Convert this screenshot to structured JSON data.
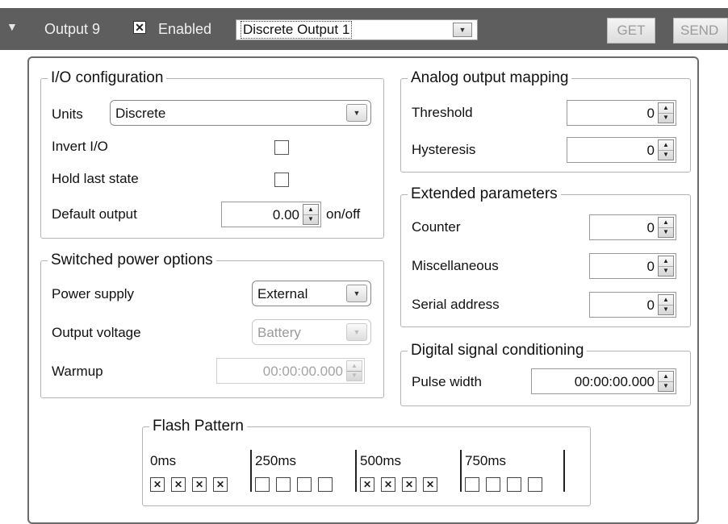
{
  "header": {
    "title": "Output 9",
    "enabled_checked": true,
    "enabled_mark": "✕",
    "enabled_label": "Enabled",
    "output_select_value": "Discrete Output 1",
    "get_label": "GET",
    "send_label": "SEND"
  },
  "io_config": {
    "legend": "I/O configuration",
    "units_label": "Units",
    "units_value": "Discrete",
    "invert_label": "Invert I/O",
    "invert_checked": false,
    "hold_label": "Hold last state",
    "hold_checked": false,
    "default_output_label": "Default output",
    "default_output_value": "0.00",
    "default_output_unit": "on/off"
  },
  "switched_power": {
    "legend": "Switched power options",
    "power_supply_label": "Power supply",
    "power_supply_value": "External",
    "output_voltage_label": "Output voltage",
    "output_voltage_value": "Battery",
    "warmup_label": "Warmup",
    "warmup_value": "00:00:00.000"
  },
  "analog_mapping": {
    "legend": "Analog output mapping",
    "threshold_label": "Threshold",
    "threshold_value": "0",
    "hysteresis_label": "Hysteresis",
    "hysteresis_value": "0"
  },
  "extended": {
    "legend": "Extended parameters",
    "counter_label": "Counter",
    "counter_value": "0",
    "misc_label": "Miscellaneous",
    "misc_value": "0",
    "serial_label": "Serial address",
    "serial_value": "0"
  },
  "digital": {
    "legend": "Digital signal conditioning",
    "pulse_label": "Pulse width",
    "pulse_value": "00:00:00.000"
  },
  "flash": {
    "legend": "Flash Pattern",
    "check_mark": "✕",
    "segments": [
      {
        "label": "0ms",
        "boxes": [
          true,
          true,
          true,
          true
        ]
      },
      {
        "label": "250ms",
        "boxes": [
          false,
          false,
          false,
          false
        ]
      },
      {
        "label": "500ms",
        "boxes": [
          true,
          true,
          true,
          true
        ]
      },
      {
        "label": "750ms",
        "boxes": [
          false,
          false,
          false,
          false
        ]
      }
    ]
  },
  "icons": {
    "collapse": "chevron-down-icon",
    "dropdown": "triangle-down-icon",
    "spinner": "spin-up-down-icon"
  }
}
